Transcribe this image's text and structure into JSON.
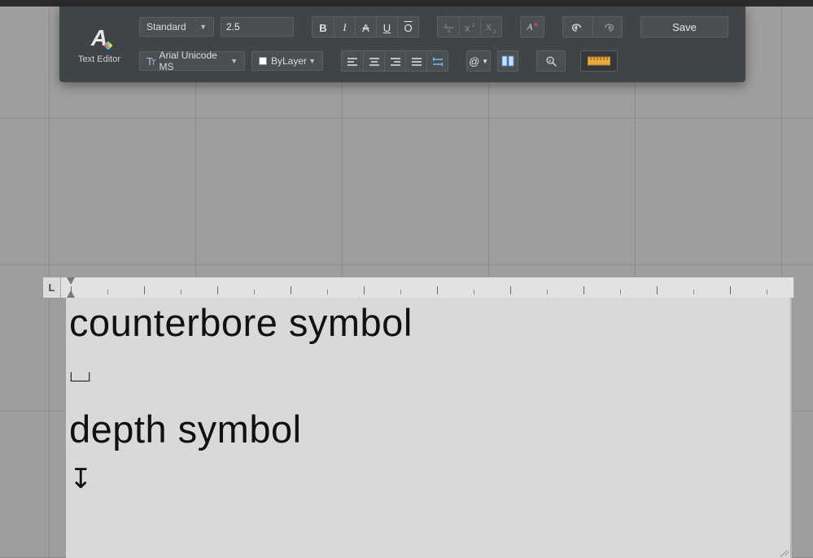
{
  "panel": {
    "title": "Text Editor"
  },
  "style": {
    "selected": "Standard"
  },
  "height_field": "2.5",
  "font": {
    "selected": "Arial Unicode MS"
  },
  "color_layer": {
    "selected": "ByLayer"
  },
  "toolbar": {
    "save_label": "Save"
  },
  "format_buttons": {
    "bold": "B",
    "italic": "I",
    "strike": "A",
    "underline": "U",
    "overline": "O"
  },
  "text_content": {
    "line1": "counterbore symbol",
    "sym1": "⌴",
    "line2": "depth symbol",
    "sym2": "↧"
  }
}
